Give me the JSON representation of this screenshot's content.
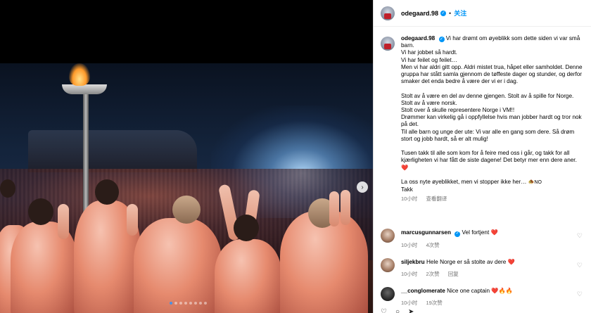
{
  "post": {
    "username": "odegaard.98",
    "follow_label": "关注",
    "caption_paragraphs": [
      "Vi har drømt om øyeblikk som dette siden vi var små barn.\nVi har jobbet så hardt.\nVi har feilet og feilet…\nMen vi har aldri gitt opp. Aldri mistet trua, håpet eller samholdet. Denne gruppa har stått samla gjennom de tøffeste dager og stunder, og derfor smaker det enda bedre å være der vi er i dag.",
      "Stolt av å være en del av denne gjengen. Stolt av å spille for Norge.\nStolt av å være norsk.\nStolt over å skulle representere Norge i VM!!\nDrømmer kan virkelig gå i oppfyllelse hvis man jobber hardt og tror nok på det.\nTil alle barn og unge der ute: Vi var alle en gang som dere. Så drøm stort og jobb hardt, så er alt mulig!",
      "Tusen takk til alle som kom for å feire med oss i går, og takk for all kjærligheten vi har fått de siste dagene! Det betyr mer enn dere aner.",
      "La oss nyte øyeblikket, men vi stopper ikke her…",
      "Takk"
    ],
    "caption_emoji": "❤️",
    "caption_last_emoji": "🧆NO",
    "time": "10小时",
    "see_translation": "查看翻译"
  },
  "comments": [
    {
      "username": "marcusgunnarsen",
      "verified": true,
      "text": "Vel fortjent",
      "emoji": "❤️",
      "time": "10小时",
      "likes": "4次赞"
    },
    {
      "username": "siljekbru",
      "verified": false,
      "text": "Hele Norge er så stolte av dere",
      "emoji": "❤️",
      "time": "10小时",
      "likes": "2次赞",
      "reply": "回复"
    },
    {
      "username": "__conglomerate",
      "verified": false,
      "text": "Nice one captain",
      "emoji": "❤️🔥🔥",
      "time": "10小时",
      "likes": "19次赞"
    }
  ],
  "media": {
    "next_icon": "chevron-right-icon",
    "slide_count": 8,
    "active_slide": 0
  },
  "colors": {
    "link": "#0095f6",
    "verified": "#0095f6",
    "heart": "#e0245e"
  }
}
